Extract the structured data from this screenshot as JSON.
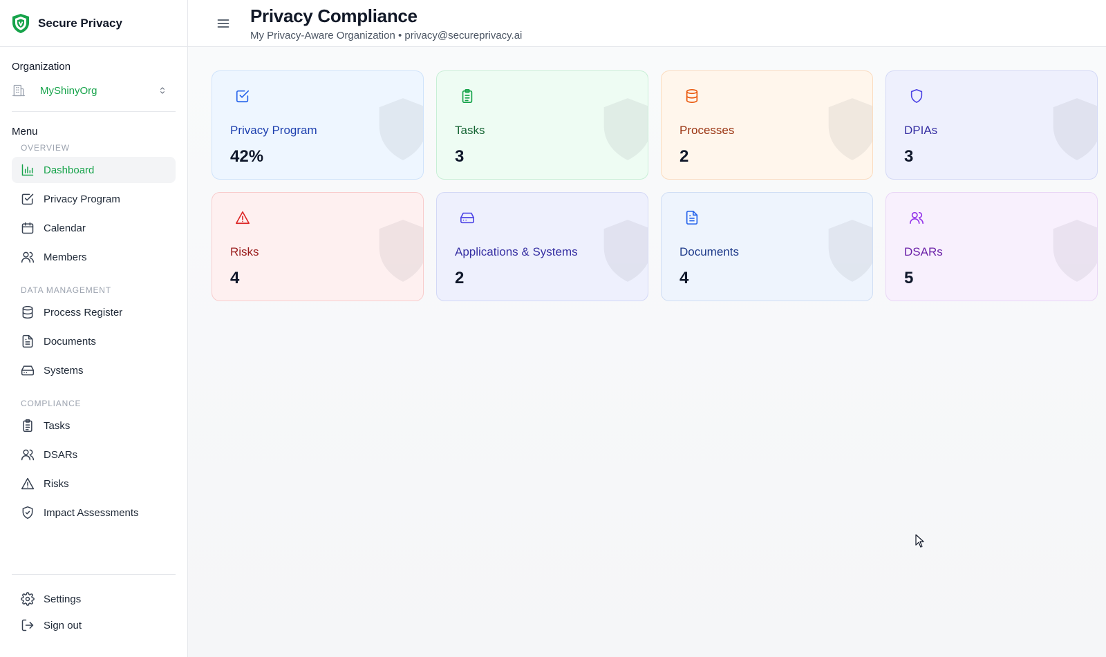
{
  "brand": {
    "name": "Secure Privacy"
  },
  "organization": {
    "title": "Organization",
    "selected": "MyShinyOrg"
  },
  "menu": {
    "title": "Menu",
    "groups": [
      {
        "label": "OVERVIEW",
        "items": [
          {
            "label": "Dashboard",
            "icon": "bar-chart-icon",
            "active": true
          },
          {
            "label": "Privacy Program",
            "icon": "checkbox-icon"
          },
          {
            "label": "Calendar",
            "icon": "calendar-icon"
          },
          {
            "label": "Members",
            "icon": "user-icon"
          }
        ]
      },
      {
        "label": "DATA MANAGEMENT",
        "items": [
          {
            "label": "Process Register",
            "icon": "database-icon"
          },
          {
            "label": "Documents",
            "icon": "document-icon"
          },
          {
            "label": "Systems",
            "icon": "hard-drive-icon"
          }
        ]
      },
      {
        "label": "COMPLIANCE",
        "items": [
          {
            "label": "Tasks",
            "icon": "clipboard-icon"
          },
          {
            "label": "DSARs",
            "icon": "users-icon"
          },
          {
            "label": "Risks",
            "icon": "warning-icon"
          },
          {
            "label": "Impact Assessments",
            "icon": "shield-check-icon"
          }
        ]
      }
    ],
    "bottom": [
      {
        "label": "Settings",
        "icon": "gear-icon"
      },
      {
        "label": "Sign out",
        "icon": "sign-out-icon"
      }
    ]
  },
  "header": {
    "title": "Privacy Compliance",
    "subtitle": "My Privacy-Aware Organization • privacy@secureprivacy.ai"
  },
  "cards": [
    {
      "label": "Privacy Program",
      "value": "42%",
      "icon": "checkbox-icon",
      "color": "#2563eb"
    },
    {
      "label": "Tasks",
      "value": "3",
      "icon": "clipboard-icon",
      "color": "#16a34a"
    },
    {
      "label": "Processes",
      "value": "2",
      "icon": "database-icon",
      "color": "#ea580c"
    },
    {
      "label": "DPIAs",
      "value": "3",
      "icon": "shield-icon",
      "color": "#4f46e5"
    },
    {
      "label": "Risks",
      "value": "4",
      "icon": "warning-icon",
      "color": "#dc2626"
    },
    {
      "label": "Applications & Systems",
      "value": "2",
      "icon": "hard-drive-icon",
      "color": "#4f46e5"
    },
    {
      "label": "Documents",
      "value": "4",
      "icon": "document-icon",
      "color": "#2563eb"
    },
    {
      "label": "DSARs",
      "value": "5",
      "icon": "users-icon",
      "color": "#9333ea"
    }
  ],
  "colors": {
    "brand_green": "#16a34a",
    "active_bg": "#f3f4f6",
    "border": "#e5e7eb"
  }
}
